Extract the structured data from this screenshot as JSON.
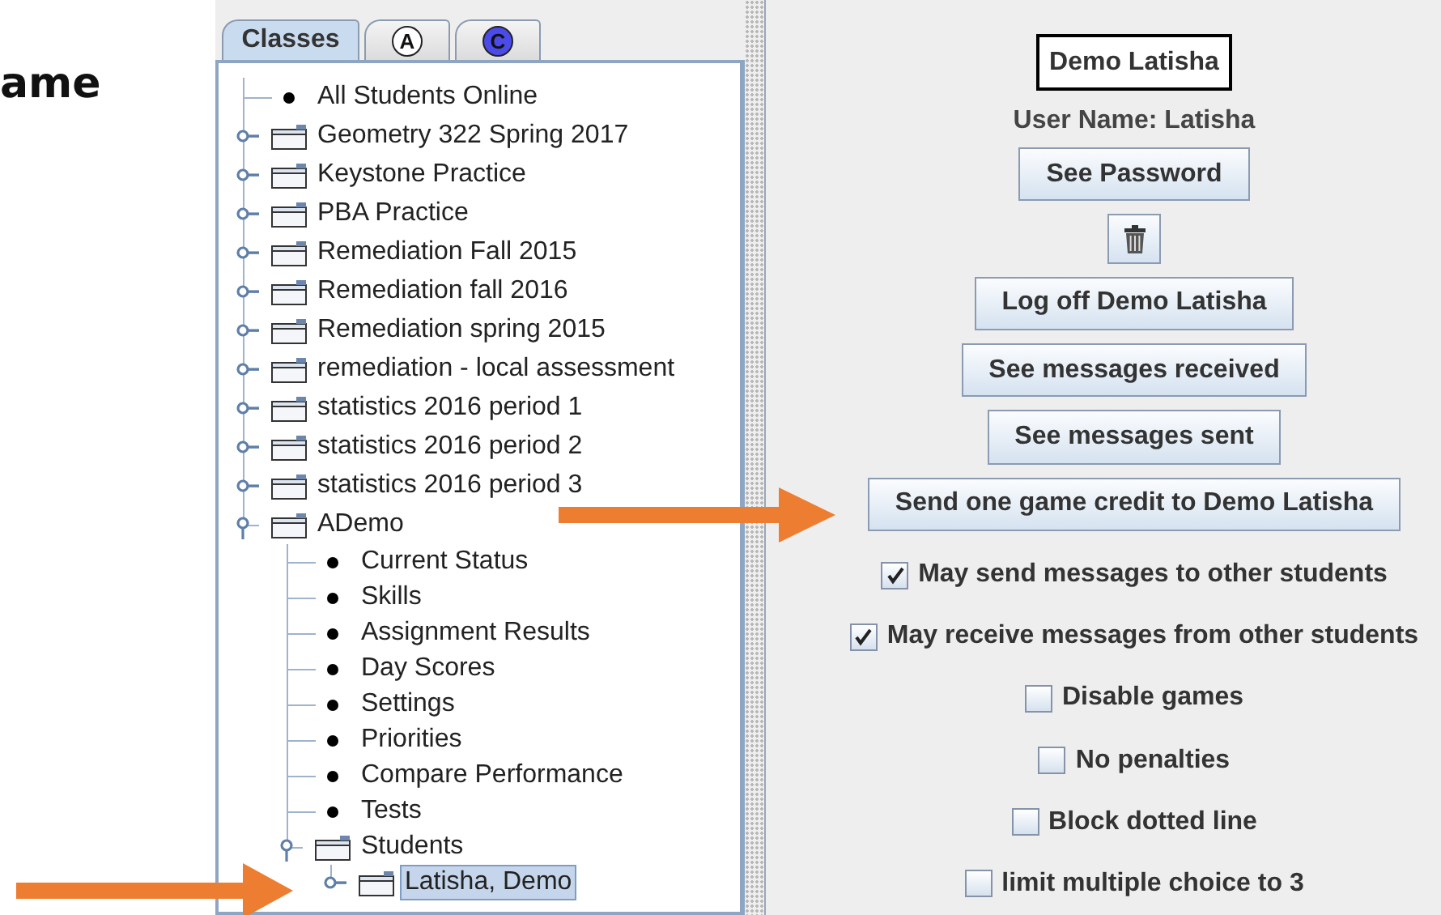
{
  "heading": "ame",
  "tabs": [
    {
      "kind": "text",
      "label": "Classes",
      "selected": true
    },
    {
      "kind": "circle",
      "label": "A",
      "color": "#ffffff",
      "selected": false
    },
    {
      "kind": "circle",
      "label": "C",
      "color": "#4b4bea",
      "selected": false
    }
  ],
  "tree": [
    {
      "kind": "leaf",
      "label": "All Students Online"
    },
    {
      "kind": "folder",
      "label": "Geometry 322 Spring 2017",
      "expanded": false,
      "selected": false
    },
    {
      "kind": "folder",
      "label": "Keystone Practice",
      "expanded": false,
      "selected": false
    },
    {
      "kind": "folder",
      "label": "PBA Practice",
      "expanded": false,
      "selected": false
    },
    {
      "kind": "folder",
      "label": "Remediation Fall 2015",
      "expanded": false,
      "selected": false
    },
    {
      "kind": "folder",
      "label": "Remediation fall 2016",
      "expanded": false,
      "selected": false
    },
    {
      "kind": "folder",
      "label": "Remediation spring 2015",
      "expanded": false,
      "selected": false
    },
    {
      "kind": "folder",
      "label": "remediation - local assessment",
      "expanded": false,
      "selected": false
    },
    {
      "kind": "folder",
      "label": "statistics 2016 period 1",
      "expanded": false,
      "selected": false
    },
    {
      "kind": "folder",
      "label": "statistics 2016 period 2",
      "expanded": false,
      "selected": false
    },
    {
      "kind": "folder",
      "label": "statistics 2016 period 3",
      "expanded": false,
      "selected": false
    },
    {
      "kind": "folder",
      "label": "ADemo",
      "expanded": true,
      "selected": false,
      "children": [
        {
          "kind": "leaf",
          "label": "Current Status"
        },
        {
          "kind": "leaf",
          "label": "Skills"
        },
        {
          "kind": "leaf",
          "label": "Assignment Results"
        },
        {
          "kind": "leaf",
          "label": "Day Scores"
        },
        {
          "kind": "leaf",
          "label": "Settings"
        },
        {
          "kind": "leaf",
          "label": "Priorities"
        },
        {
          "kind": "leaf",
          "label": "Compare Performance"
        },
        {
          "kind": "leaf",
          "label": "Tests"
        },
        {
          "kind": "folder",
          "label": "Students",
          "expanded": true,
          "selected": false,
          "children": [
            {
              "kind": "folder",
              "label": "Latisha, Demo",
              "expanded": false,
              "selected": true
            }
          ]
        }
      ]
    }
  ],
  "student": {
    "name": "Demo Latisha",
    "user_name": "User Name: Latisha"
  },
  "controls": [
    {
      "kind": "button",
      "label": "See Password"
    },
    {
      "kind": "trash"
    },
    {
      "kind": "button",
      "label": "Log off Demo Latisha"
    },
    {
      "kind": "button",
      "label": "See messages received"
    },
    {
      "kind": "button",
      "label": "See messages sent"
    },
    {
      "kind": "button",
      "label": "Send one game credit to Demo Latisha"
    },
    {
      "kind": "checkbox",
      "label": "May send messages to other students",
      "checked": true
    },
    {
      "kind": "checkbox",
      "label": "May receive messages from other students",
      "checked": true
    },
    {
      "kind": "checkbox",
      "label": "Disable games",
      "checked": false
    },
    {
      "kind": "checkbox",
      "label": "No penalties",
      "checked": false
    },
    {
      "kind": "checkbox",
      "label": "Block dotted line",
      "checked": false
    },
    {
      "kind": "checkbox",
      "label": "limit multiple choice to 3",
      "checked": false
    }
  ]
}
